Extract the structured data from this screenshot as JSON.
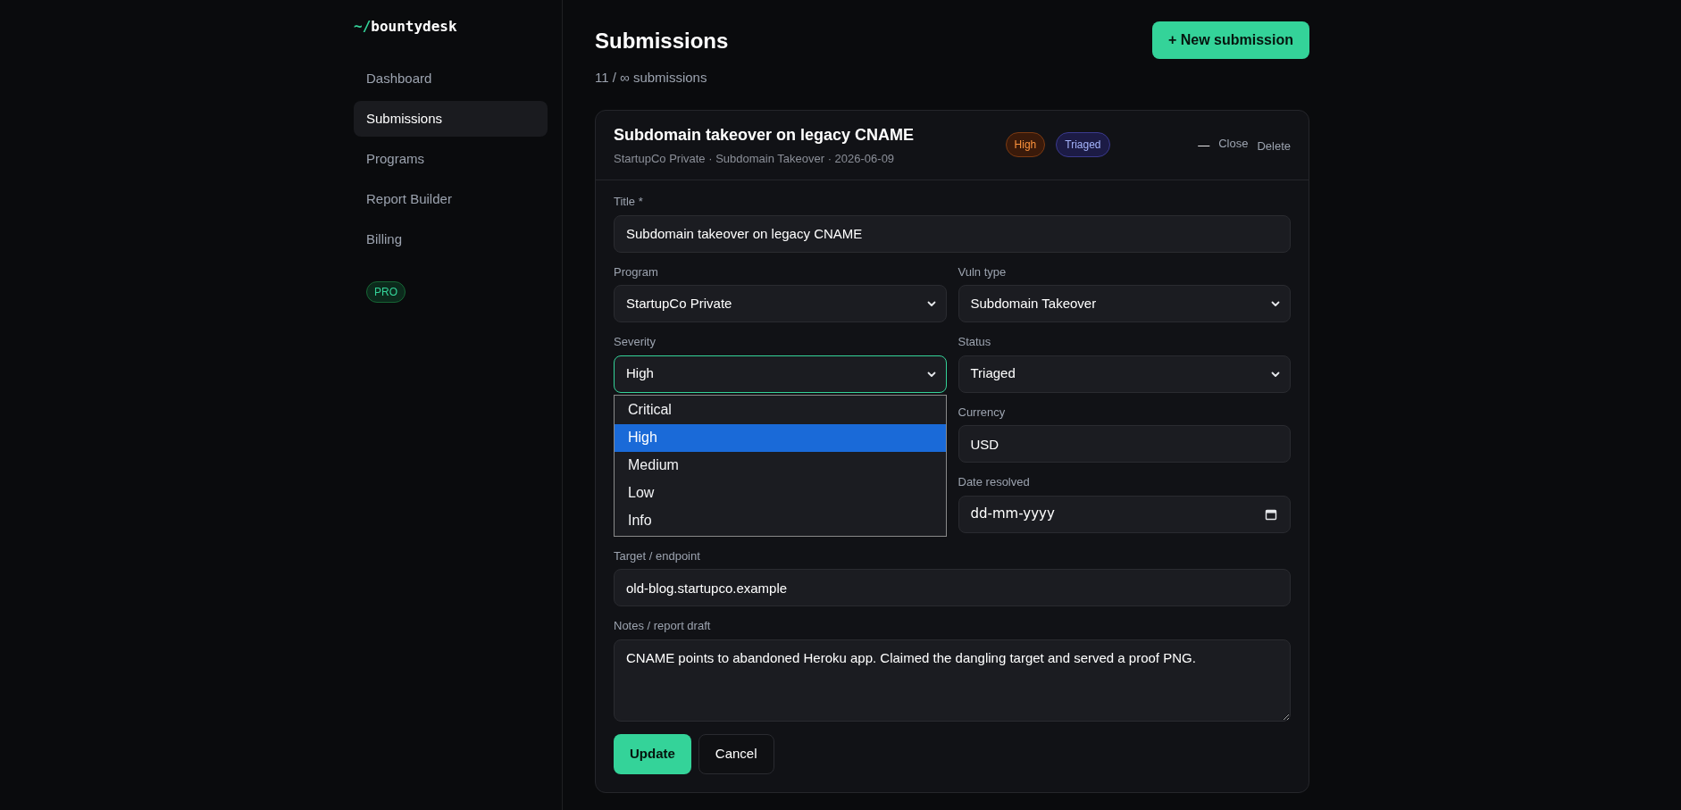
{
  "sidebar": {
    "logo": {
      "prefix": "~/",
      "name": "bountydesk"
    },
    "items": [
      {
        "label": "Dashboard",
        "selected": false
      },
      {
        "label": "Submissions",
        "selected": true
      },
      {
        "label": "Programs",
        "selected": false
      },
      {
        "label": "Report Builder",
        "selected": false
      },
      {
        "label": "Billing",
        "selected": false
      }
    ],
    "plan_badge": "PRO"
  },
  "header": {
    "title": "Submissions",
    "subtitle": "11 / ∞ submissions",
    "new_button": "+ New submission"
  },
  "card": {
    "title": "Subdomain takeover on legacy CNAME",
    "meta": "StartupCo Private · Subdomain Takeover · 2026-06-09",
    "badges": [
      {
        "label": "High",
        "kind": "severity"
      },
      {
        "label": "Triaged",
        "kind": "status"
      }
    ],
    "collapse_glyph": "—",
    "actions": [
      "Close",
      "Delete"
    ],
    "form": {
      "rows": [
        {
          "columns": [
            [
              {
                "kind": "text",
                "label": "Title *",
                "value": "Subdomain takeover on legacy CNAME"
              }
            ]
          ]
        },
        {
          "columns": [
            [
              {
                "kind": "select",
                "label": "Program",
                "value": "StartupCo Private"
              }
            ],
            [
              {
                "kind": "select",
                "label": "Vuln type",
                "value": "Subdomain Takeover"
              }
            ]
          ]
        },
        {
          "columns": [
            [
              {
                "kind": "select",
                "label": "Severity",
                "value": "High",
                "focused": true,
                "expanded": true,
                "options": [
                  {
                    "label": "Critical",
                    "selected": false
                  },
                  {
                    "label": "High",
                    "selected": true
                  },
                  {
                    "label": "Medium",
                    "selected": false
                  },
                  {
                    "label": "Low",
                    "selected": false
                  },
                  {
                    "label": "Info",
                    "selected": false
                  }
                ]
              }
            ],
            [
              {
                "kind": "select",
                "label": "Status",
                "value": "Triaged"
              },
              {
                "kind": "text",
                "label": "Currency",
                "value": "USD"
              },
              {
                "kind": "date",
                "label": "Date resolved",
                "placeholder": "dd-mm-yyyy"
              }
            ]
          ]
        },
        {
          "columns": [
            [
              {
                "kind": "text",
                "label": "Target / endpoint",
                "value": "old-blog.startupco.example"
              }
            ]
          ]
        },
        {
          "columns": [
            [
              {
                "kind": "textarea",
                "label": "Notes / report draft",
                "value": "CNAME points to abandoned Heroku app. Claimed the dangling target and served a proof PNG."
              }
            ]
          ]
        }
      ],
      "buttons": [
        {
          "label": "Update",
          "kind": "primary"
        },
        {
          "label": "Cancel",
          "kind": "secondary"
        }
      ]
    }
  }
}
